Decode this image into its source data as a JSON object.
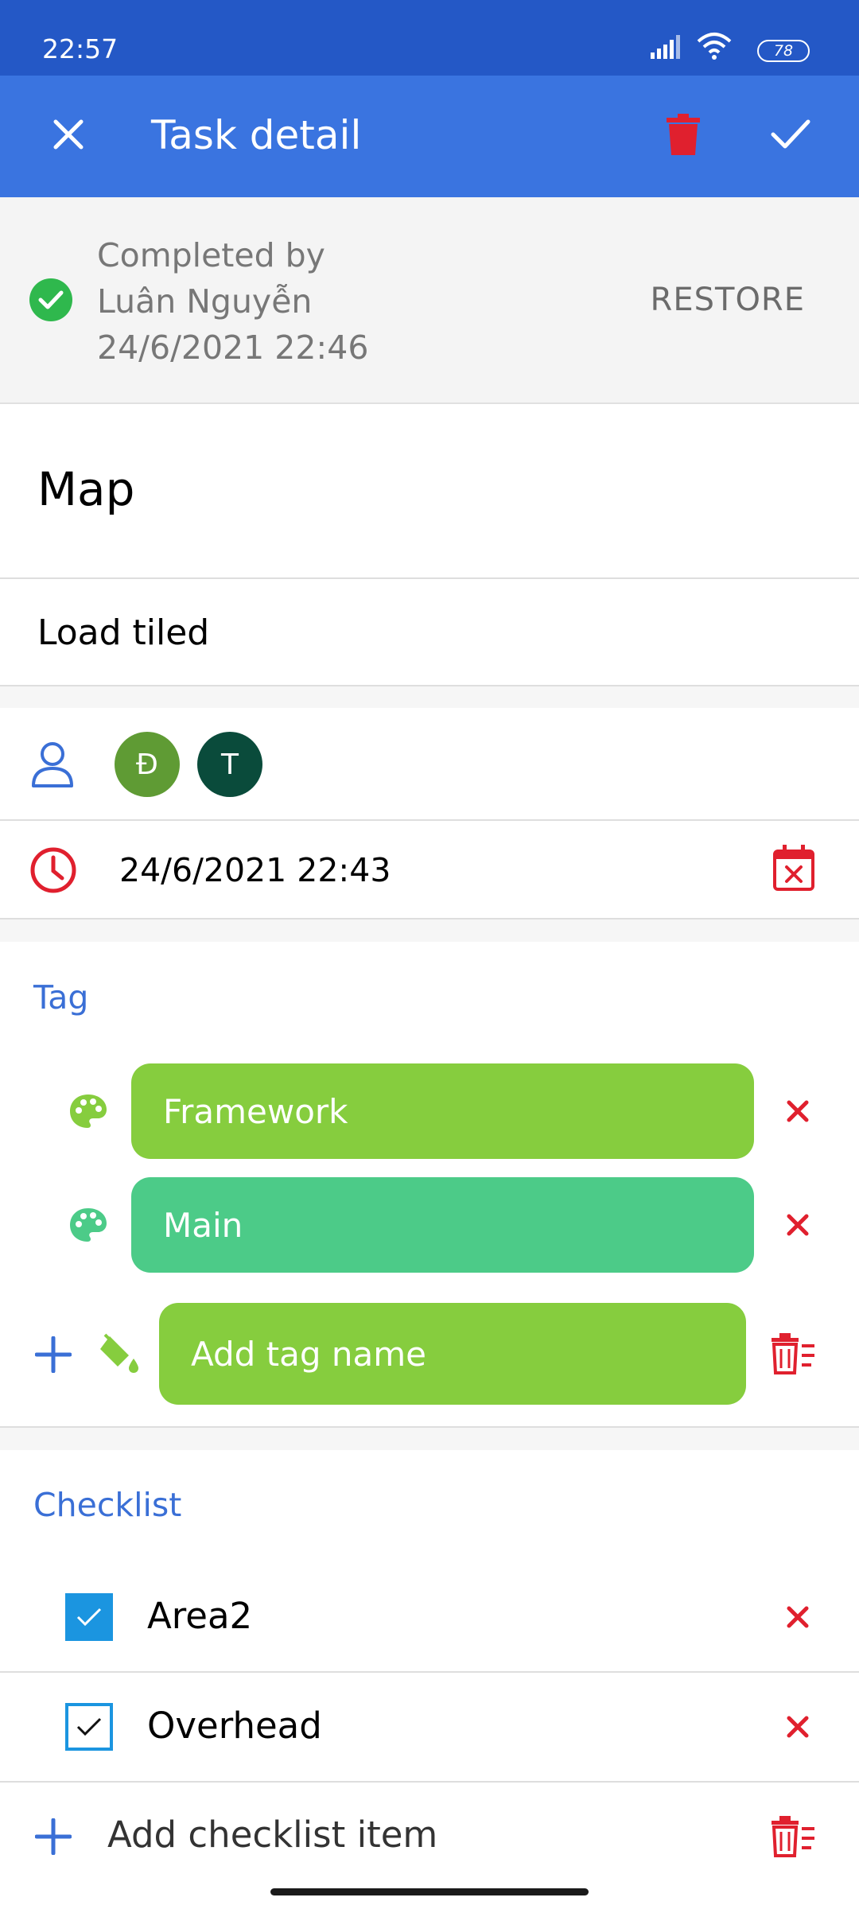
{
  "status_bar": {
    "time": "22:57",
    "battery": "78"
  },
  "app_bar": {
    "title": "Task detail",
    "close_icon": "close-icon",
    "delete_icon": "trash-icon",
    "save_icon": "check-icon"
  },
  "completion": {
    "line1": "Completed by",
    "line2": "Luân Nguyễn",
    "line3": "24/6/2021 22:46",
    "restore_label": "RESTORE"
  },
  "task": {
    "title": "Map",
    "description": "Load tiled"
  },
  "assignees": [
    {
      "initial": "Đ",
      "color": "#5f9b34"
    },
    {
      "initial": "T",
      "color": "#0a4b3b"
    }
  ],
  "due_date": "24/6/2021 22:43",
  "tag_section": {
    "title": "Tag",
    "tags": [
      {
        "name": "Framework",
        "color": "#86cd3e"
      },
      {
        "name": "Main",
        "color": "#4ccb88"
      }
    ],
    "add_placeholder": "Add tag name"
  },
  "checklist_section": {
    "title": "Checklist",
    "items": [
      {
        "label": "Area2",
        "checked": true
      },
      {
        "label": "Overhead",
        "checked": true
      }
    ],
    "add_placeholder": "Add checklist item"
  },
  "colors": {
    "primary": "#3a74e0",
    "status_bar": "#2458c6",
    "danger": "#e0202e",
    "link": "#3a6fd6",
    "success": "#2fb84d"
  }
}
